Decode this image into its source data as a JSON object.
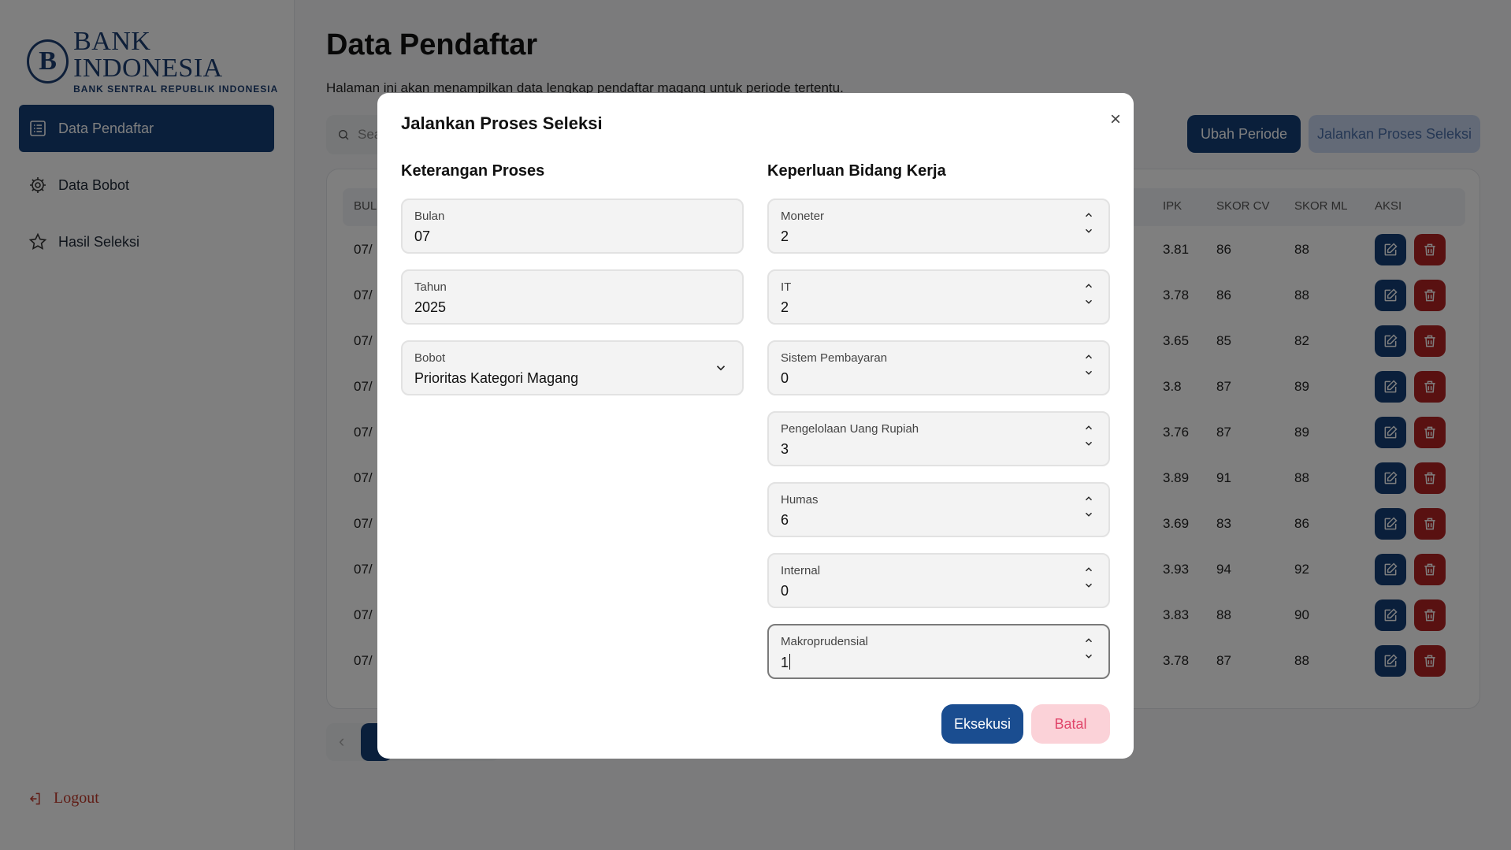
{
  "sidebar": {
    "logo_title": "BANK INDONESIA",
    "logo_subtitle": "BANK SENTRAL REPUBLIK INDONESIA",
    "items": [
      {
        "label": "Data Pendaftar",
        "icon": "list-icon",
        "active": true
      },
      {
        "label": "Data Bobot",
        "icon": "gear-icon",
        "active": false
      },
      {
        "label": "Hasil Seleksi",
        "icon": "star-icon",
        "active": false
      }
    ],
    "logout_label": "Logout"
  },
  "main": {
    "title": "Data Pendaftar",
    "description": "Halaman ini akan menampilkan data lengkap pendaftar magang untuk periode tertentu.",
    "search_placeholder": "Sea",
    "ubah_periode_label": "Ubah Periode",
    "jalankan_label": "Jalankan Proses Seleksi",
    "table": {
      "headers": [
        "BUL",
        "IPK",
        "SKOR CV",
        "SKOR ML",
        "AKSI"
      ],
      "rows": [
        {
          "bulan": "07/",
          "ipk": "3.81",
          "cv": "86",
          "ml": "88"
        },
        {
          "bulan": "07/",
          "ipk": "3.78",
          "cv": "86",
          "ml": "88"
        },
        {
          "bulan": "07/",
          "ipk": "3.65",
          "cv": "85",
          "ml": "82"
        },
        {
          "bulan": "07/",
          "ipk": "3.8",
          "cv": "87",
          "ml": "89"
        },
        {
          "bulan": "07/",
          "ipk": "3.76",
          "cv": "87",
          "ml": "89"
        },
        {
          "bulan": "07/",
          "ipk": "3.89",
          "cv": "91",
          "ml": "88"
        },
        {
          "bulan": "07/",
          "ipk": "3.69",
          "cv": "83",
          "ml": "86"
        },
        {
          "bulan": "07/",
          "ipk": "3.93",
          "cv": "94",
          "ml": "92"
        },
        {
          "bulan": "07/",
          "ipk": "3.83",
          "cv": "88",
          "ml": "90"
        },
        {
          "bulan": "07/",
          "ipk": "3.78",
          "cv": "87",
          "ml": "88"
        }
      ]
    },
    "pagination": {
      "prev_label": "‹"
    }
  },
  "modal": {
    "title": "Jalankan Proses Seleksi",
    "close_label": "×",
    "left_section_title": "Keterangan Proses",
    "right_section_title": "Keperluan Bidang Kerja",
    "left_fields": [
      {
        "label": "Bulan",
        "value": "07"
      },
      {
        "label": "Tahun",
        "value": "2025"
      },
      {
        "label": "Bobot",
        "value": "Prioritas Kategori Magang"
      }
    ],
    "right_fields": [
      {
        "label": "Moneter",
        "value": "2"
      },
      {
        "label": "IT",
        "value": "2"
      },
      {
        "label": "Sistem Pembayaran",
        "value": "0"
      },
      {
        "label": "Pengelolaan Uang Rupiah",
        "value": "3"
      },
      {
        "label": "Humas",
        "value": "6"
      },
      {
        "label": "Internal",
        "value": "0"
      },
      {
        "label": "Makroprudensial",
        "value": "1"
      }
    ],
    "execute_label": "Eksekusi",
    "cancel_label": "Batal"
  },
  "colors": {
    "primary": "#143e76",
    "danger": "#b22222",
    "cancel_bg": "#fbd2d8",
    "cancel_text": "#e0456a"
  }
}
